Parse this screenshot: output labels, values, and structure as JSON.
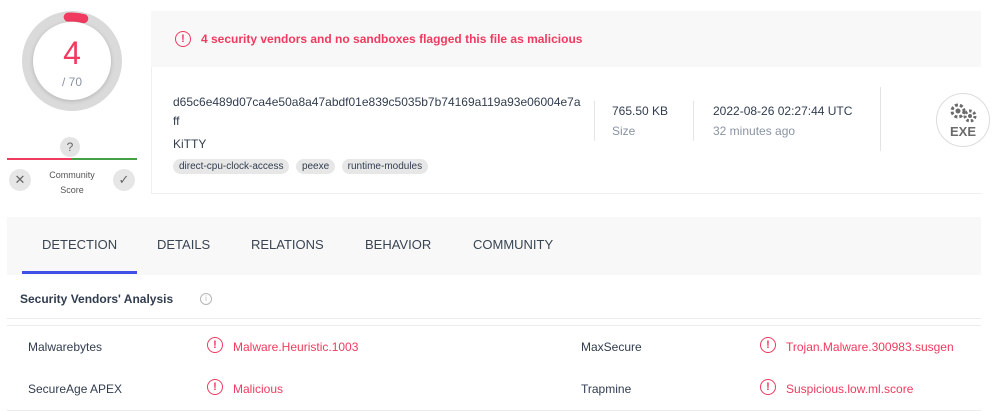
{
  "score": {
    "detections": "4",
    "total": "/ 70",
    "ring_fraction": 0.057
  },
  "community": {
    "badge": "?",
    "label": "Community Score",
    "down_glyph": "✕",
    "up_glyph": "✓"
  },
  "alert": {
    "icon_glyph": "!",
    "text": "4 security vendors and no sandboxes flagged this file as malicious"
  },
  "file": {
    "hash": "d65c6e489d07ca4e50a8a47abdf01e839c5035b7b74169a119a93e06004e7aff",
    "name": "KiTTY",
    "tags": [
      "direct-cpu-clock-access",
      "peexe",
      "runtime-modules"
    ],
    "size_value": "765.50 KB",
    "size_label": "Size",
    "date_value": "2022-08-26 02:27:44 UTC",
    "date_label": "32 minutes ago",
    "type_label": "EXE"
  },
  "tabs": [
    {
      "label": "DETECTION",
      "active": true
    },
    {
      "label": "DETAILS",
      "active": false
    },
    {
      "label": "RELATIONS",
      "active": false
    },
    {
      "label": "BEHAVIOR",
      "active": false
    },
    {
      "label": "COMMUNITY",
      "active": false
    }
  ],
  "analysis": {
    "title": "Security Vendors' Analysis",
    "info_glyph": "i",
    "rows": [
      {
        "left_vendor": "Malwarebytes",
        "left_result": "Malware.Heuristic.1003",
        "right_vendor": "MaxSecure",
        "right_result": "Trojan.Malware.300983.susgen"
      },
      {
        "left_vendor": "SecureAge APEX",
        "left_result": "Malicious",
        "right_vendor": "Trapmine",
        "right_result": "Suspicious.low.ml.score"
      }
    ]
  },
  "colors": {
    "malicious": "#f03a5f",
    "accent": "#3f51e8",
    "ring_bg": "#dadada"
  }
}
